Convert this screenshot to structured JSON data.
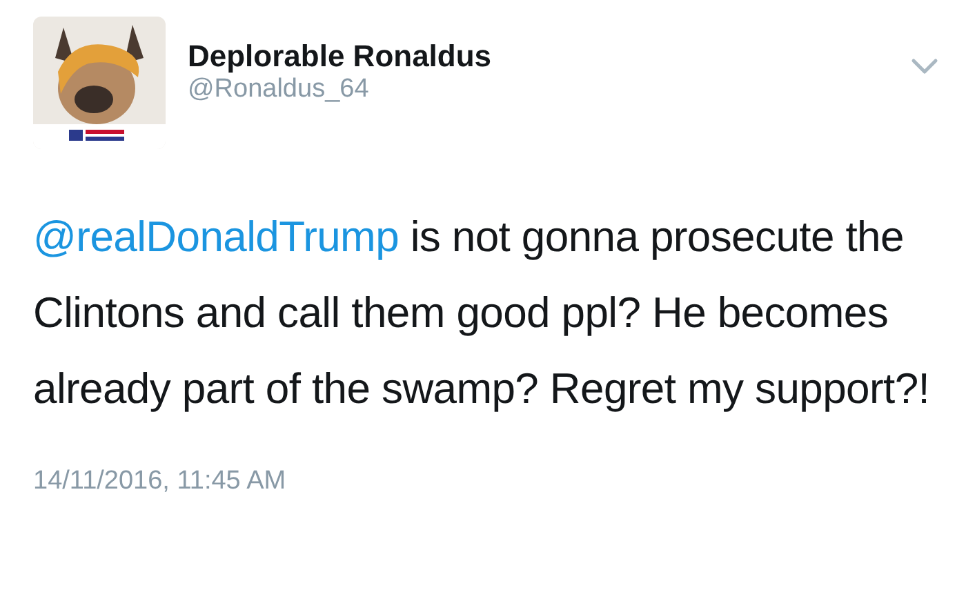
{
  "tweet": {
    "display_name": "Deplorable Ronaldus",
    "handle": "@Ronaldus_64",
    "mention": "@realDonaldTrump",
    "text": " is not gonna prosecute the Clintons and call them good ppl? He becomes already part of the swamp? Regret my support?!",
    "timestamp": "14/11/2016, 11:45 AM"
  }
}
